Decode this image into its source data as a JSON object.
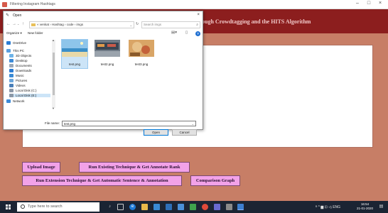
{
  "app": {
    "title": "Filtering Instagram Hashtags",
    "banner": "ough Crowdtagging and the HITS Algorithm",
    "minimize": "–",
    "maximize": "□",
    "close": "×"
  },
  "buttons": {
    "upload": "Upload Image",
    "existing": "Run Existing Technique & Get Annotate Rank",
    "extension": "Run Extension Technique & Get Automatic Sentence & Annotation",
    "comparison": "Comparison Graph"
  },
  "dialog": {
    "title": "Open",
    "close": "×",
    "breadcrumb": "« venkat › Hashtag › code › imgs",
    "search_placeholder": "Search imgs",
    "organize": "Organize ▾",
    "new_folder": "New folder",
    "help": "?",
    "nav_items": [
      "OneDrive",
      "This PC",
      "3D Objects",
      "Desktop",
      "Documents",
      "Downloads",
      "Music",
      "Pictures",
      "Videos",
      "Local Disk (C:)",
      "Local Disk (E:)",
      "Network"
    ],
    "files": [
      "test.png",
      "test2.png",
      "test3.png"
    ],
    "file_name_label": "File name:",
    "file_name_value": "test.png",
    "open": "Open",
    "cancel": "Cancel"
  },
  "taskbar": {
    "search_placeholder": "Type here to search",
    "tray": "ᴿ ^ ▆ ⊡ ◁ᵢ ENG",
    "time": "16:54",
    "date": "21-01-2020"
  },
  "colors": {
    "background": "#c77e66",
    "banner": "#8c1e1e",
    "button": "#f2a2e8",
    "taskbar": "#1b2433"
  }
}
